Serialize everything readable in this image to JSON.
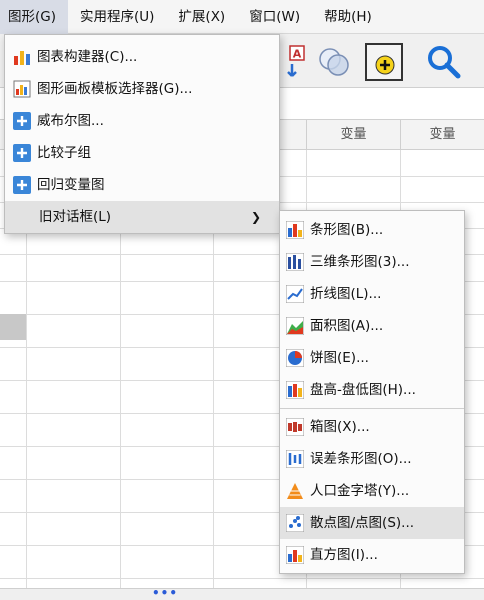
{
  "menubar": {
    "items": [
      {
        "label": "图形(G)"
      },
      {
        "label": "实用程序(U)"
      },
      {
        "label": "扩展(X)"
      },
      {
        "label": "窗口(W)"
      },
      {
        "label": "帮助(H)"
      }
    ]
  },
  "toolbar": {
    "icons": [
      "text-a-icon",
      "overlap-circles-icon",
      "add-variable-icon",
      "search-icon"
    ]
  },
  "grid": {
    "headers": [
      "变量",
      "变量"
    ]
  },
  "graph_menu": {
    "items": [
      {
        "label": "图表构建器(C)...",
        "icon": "chart-builder-icon"
      },
      {
        "label": "图形画板模板选择器(G)...",
        "icon": "template-chooser-icon"
      },
      {
        "label": "威布尔图...",
        "icon": "plus-icon"
      },
      {
        "label": "比较子组",
        "icon": "plus-icon"
      },
      {
        "label": "回归变量图",
        "icon": "plus-icon"
      },
      {
        "label": "旧对话框(L)",
        "icon": "none"
      }
    ]
  },
  "legacy_menu": {
    "items": [
      {
        "label": "条形图(B)...",
        "icon": "bar-chart-icon"
      },
      {
        "label": "三维条形图(3)...",
        "icon": "3d-bar-chart-icon"
      },
      {
        "label": "折线图(L)...",
        "icon": "line-chart-icon"
      },
      {
        "label": "面积图(A)...",
        "icon": "area-chart-icon"
      },
      {
        "label": "饼图(E)...",
        "icon": "pie-chart-icon"
      },
      {
        "label": "盘高-盘低图(H)...",
        "icon": "high-low-chart-icon"
      },
      {
        "label": "箱图(X)...",
        "icon": "boxplot-icon"
      },
      {
        "label": "误差条形图(O)...",
        "icon": "error-bar-icon"
      },
      {
        "label": "人口金字塔(Y)...",
        "icon": "pyramid-icon"
      },
      {
        "label": "散点图/点图(S)...",
        "icon": "scatter-icon"
      },
      {
        "label": "直方图(I)...",
        "icon": "histogram-icon"
      }
    ]
  }
}
